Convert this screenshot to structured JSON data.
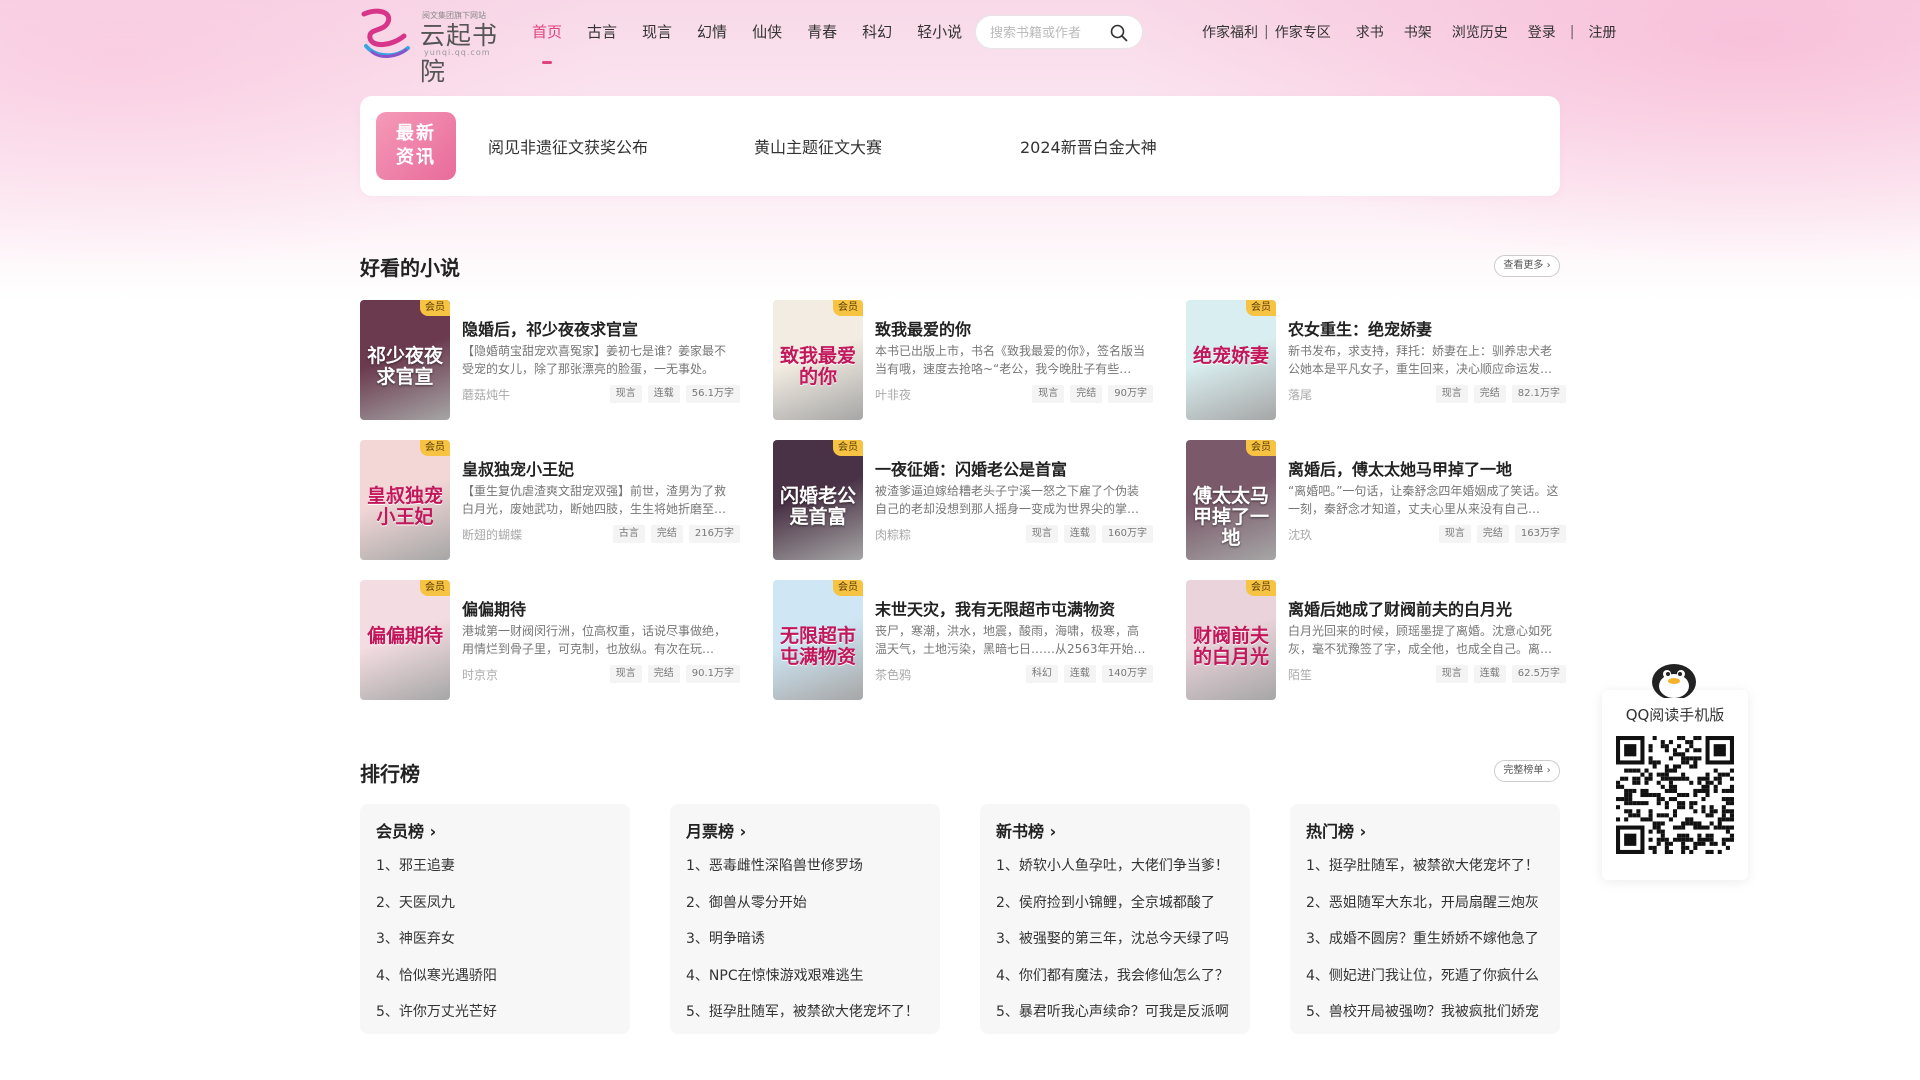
{
  "header": {
    "logo": {
      "name": "云起书院",
      "slogan": "阅文集团旗下网站",
      "url": "yunqi.qq.com",
      "icon": "yunqi-swirl-logo"
    },
    "nav": [
      "首页",
      "古言",
      "现言",
      "幻情",
      "仙侠",
      "青春",
      "科幻",
      "轻小说"
    ],
    "active_nav": "首页",
    "search": {
      "placeholder": "搜索书籍或作者",
      "icon": "search-icon"
    },
    "links": {
      "author_welfare": "作家福利",
      "author_zone": "作家专区",
      "request_book": "求书",
      "bookshelf": "书架",
      "history": "浏览历史",
      "login": "登录",
      "register": "注册",
      "sep": "|"
    }
  },
  "news": {
    "badge": "最新资讯",
    "badge_lines": [
      "最新",
      "资讯"
    ],
    "items": [
      "阅见非遗征文获奖公布",
      "黄山主题征文大赛",
      "2024新晋白金大神"
    ]
  },
  "novels": {
    "title": "好看的小说",
    "more": "查看更多",
    "vip_label": "会员",
    "books": [
      {
        "title": "隐婚后，祁少夜夜求官宣",
        "cover_text": "祁少夜夜求官宣",
        "desc": "【隐婚萌宝甜宠欢喜冤家】姜初七是谁？姜家最不受宠的女儿，除了那张漂亮的脸蛋，一无事处。",
        "author": "蘑菇炖牛",
        "tags": [
          "现言",
          "连载",
          "56.1万字"
        ],
        "cover_color": "#6b3a4e"
      },
      {
        "title": "致我最爱的你",
        "cover_text": "致我最爱的你",
        "desc": "本书已出版上市，书名《致我最爱的你》，签名版当当有哦，速度去抢咯~“老公，我今晚肚子有些…",
        "author": "叶非夜",
        "tags": [
          "现言",
          "完结",
          "90万字"
        ],
        "cover_color": "#f3ece2"
      },
      {
        "title": "农女重生：绝宠娇妻",
        "cover_text": "绝宠娇妻",
        "desc": "新书发布，求支持，拜托：娇妻在上：驯养忠犬老公她本是平凡女子，重生回来，决心顺应命运发…",
        "author": "落尾",
        "tags": [
          "现言",
          "完结",
          "82.1万字"
        ],
        "cover_color": "#d9eef0"
      },
      {
        "title": "皇叔独宠小王妃",
        "cover_text": "皇叔独宠小王妃",
        "desc": "【重生复仇虐渣爽文甜宠双强】前世，渣男为了救白月光，废她武功，断她四肢，生生将她折磨至…",
        "author": "断翅的蝴蝶",
        "tags": [
          "古言",
          "完结",
          "216万字"
        ],
        "cover_color": "#f3d7d7"
      },
      {
        "title": "一夜征婚：闪婚老公是首富",
        "cover_text": "闪婚老公是首富",
        "desc": "被渣爹逼迫嫁给糟老头子宁溪一怒之下雇了个伪装自己的老却没想到那人摇身一变成为世界尖的掌…",
        "author": "肉粽粽",
        "tags": [
          "现言",
          "连载",
          "160万字"
        ],
        "cover_color": "#4a3246"
      },
      {
        "title": "离婚后，傅太太她马甲掉了一地",
        "cover_text": "傅太太马甲掉了一地",
        "desc": "“离婚吧。”一句话，让秦舒念四年婚姻成了笑话。这一刻，秦舒念才知道，丈夫心里从来没有自己…",
        "author": "沈玖",
        "tags": [
          "现言",
          "完结",
          "163万字"
        ],
        "cover_color": "#7a5a6a"
      },
      {
        "title": "偏偏期待",
        "cover_text": "偏偏期待",
        "desc": "港城第一财阀闵行洲，位高权重，话说尽事做绝，用情烂到骨子里，可克制，也放纵。有次在玩…",
        "author": "时京京",
        "tags": [
          "现言",
          "完结",
          "90.1万字"
        ],
        "cover_color": "#f4dde2"
      },
      {
        "title": "末世天灾，我有无限超市屯满物资",
        "cover_text": "无限超市屯满物资",
        "desc": "丧尸，寒潮，洪水，地震，酸雨，海啸，极寒，高温天气，土地污染，黑暗七日……从2563年开始…",
        "author": "茶色鸦",
        "tags": [
          "科幻",
          "连载",
          "140万字"
        ],
        "cover_color": "#cfe7f5"
      },
      {
        "title": "离婚后她成了财阀前夫的白月光",
        "cover_text": "财阀前夫的白月光",
        "desc": "白月光回来的时候，顾瑶墨提了离婚。沈意心如死灰，毫不犹豫签了字，成全他，也成全自己。离…",
        "author": "陌笙",
        "tags": [
          "现言",
          "连载",
          "62.5万字"
        ],
        "cover_color": "#ead3da"
      }
    ]
  },
  "rankings": {
    "title": "排行榜",
    "more": "完整榜单",
    "columns": [
      {
        "title": "会员榜",
        "items": [
          "1、邪王追妻",
          "2、天医凤九",
          "3、神医弃女",
          "4、恰似寒光遇骄阳",
          "5、许你万丈光芒好"
        ]
      },
      {
        "title": "月票榜",
        "items": [
          "1、恶毒雌性深陷兽世修罗场",
          "2、御兽从零分开始",
          "3、明争暗诱",
          "4、NPC在惊悚游戏艰难逃生",
          "5、挺孕肚随军，被禁欲大佬宠坏了！"
        ]
      },
      {
        "title": "新书榜",
        "items": [
          "1、娇软小人鱼孕吐，大佬们争当爹！",
          "2、侯府捡到小锦鲤，全京城都酸了",
          "3、被强娶的第三年，沈总今天绿了吗",
          "4、你们都有魔法，我会修仙怎么了？",
          "5、暴君听我心声续命？可我是反派啊"
        ]
      },
      {
        "title": "热门榜",
        "items": [
          "1、挺孕肚随军，被禁欲大佬宠坏了！",
          "2、恶姐随军大东北，开局扇醒三炮灰",
          "3、成婚不圆房？重生娇娇不嫁他急了",
          "4、侧妃进门我让位，死遁了你疯什么",
          "5、兽校开局被强吻？我被疯批们娇宠"
        ]
      }
    ]
  },
  "qr": {
    "label": "QQ阅读手机版",
    "icon": "qq-penguin-icon"
  },
  "colors": {
    "accent": "#e0447f",
    "vip": "#f6c343",
    "panel": "#f7f7f7"
  }
}
